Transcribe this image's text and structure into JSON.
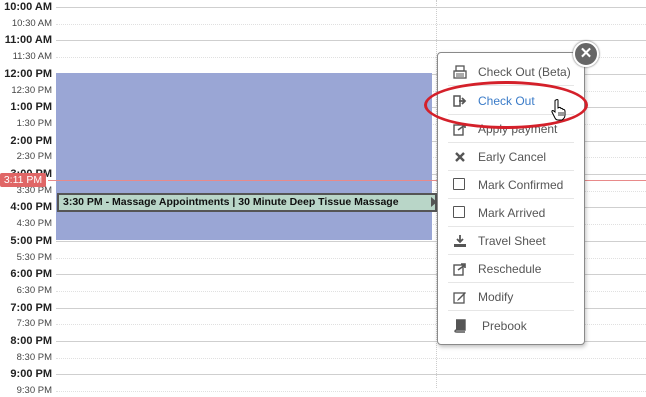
{
  "calendar": {
    "times": [
      {
        "label": "10:00 AM",
        "hour": true
      },
      {
        "label": "10:30 AM",
        "hour": false
      },
      {
        "label": "11:00 AM",
        "hour": true
      },
      {
        "label": "11:30 AM",
        "hour": false
      },
      {
        "label": "12:00 PM",
        "hour": true
      },
      {
        "label": "12:30 PM",
        "hour": false
      },
      {
        "label": "1:00 PM",
        "hour": true
      },
      {
        "label": "1:30 PM",
        "hour": false
      },
      {
        "label": "2:00 PM",
        "hour": true
      },
      {
        "label": "2:30 PM",
        "hour": false
      },
      {
        "label": "3:00 PM",
        "hour": true
      },
      {
        "label": "3:30 PM",
        "hour": false
      },
      {
        "label": "4:00 PM",
        "hour": true
      },
      {
        "label": "4:30 PM",
        "hour": false
      },
      {
        "label": "5:00 PM",
        "hour": true
      },
      {
        "label": "5:30 PM",
        "hour": false
      },
      {
        "label": "6:00 PM",
        "hour": true
      },
      {
        "label": "6:30 PM",
        "hour": false
      },
      {
        "label": "7:00 PM",
        "hour": true
      },
      {
        "label": "7:30 PM",
        "hour": false
      },
      {
        "label": "8:00 PM",
        "hour": true
      },
      {
        "label": "8:30 PM",
        "hour": false
      },
      {
        "label": "9:00 PM",
        "hour": true
      },
      {
        "label": "9:30 PM",
        "hour": false
      }
    ],
    "current_time": "3:11 PM",
    "appointment_label": "3:30 PM - Massage Appointments | 30 Minute Deep Tissue Massage",
    "colors": {
      "block": "#9aa6d5",
      "appointment": "#b9d6c8",
      "now": "#e06666",
      "highlight": "#d4202a",
      "link": "#3a7bc8"
    }
  },
  "context_menu": {
    "close_label": "✕",
    "items": [
      {
        "label": "Check Out (Beta)",
        "icon": "register-icon"
      },
      {
        "label": "Check Out",
        "icon": "sign-out-icon",
        "active": true
      },
      {
        "label": "Apply payment",
        "icon": "share-icon"
      },
      {
        "label": "Early Cancel",
        "icon": "x-icon"
      },
      {
        "label": "Mark Confirmed",
        "icon": "checkbox-icon"
      },
      {
        "label": "Mark Arrived",
        "icon": "checkbox-icon"
      },
      {
        "label": "Travel Sheet",
        "icon": "download-icon"
      },
      {
        "label": "Reschedule",
        "icon": "share-icon"
      },
      {
        "label": "Modify",
        "icon": "edit-icon"
      },
      {
        "label": "Prebook",
        "icon": "book-icon"
      }
    ]
  }
}
